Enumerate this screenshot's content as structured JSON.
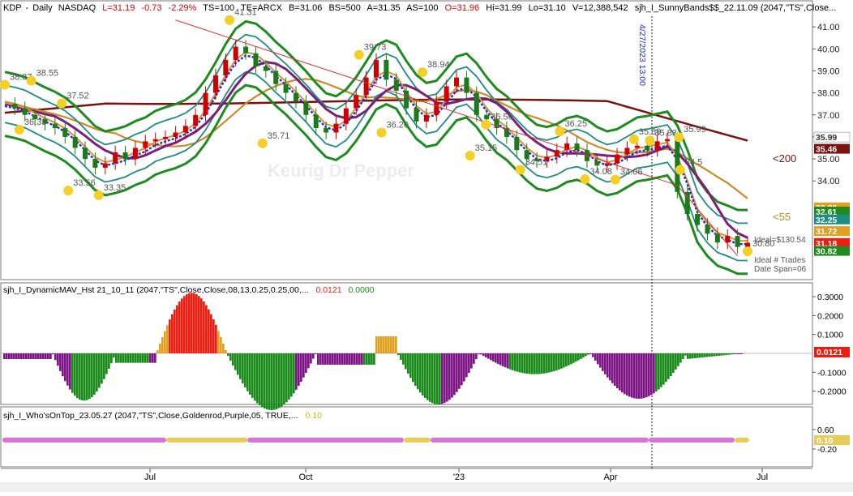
{
  "header": {
    "symbol": "KDP",
    "interval": "Daily",
    "exchange": "NASDAQ",
    "last": "L=31.19",
    "change": "-0.73",
    "change_pct": "-2.29%",
    "ts": "TS=100",
    "te": "TE=ARCX",
    "bid": "B=31.06",
    "bid_size": "BS=500",
    "ask": "A=31.35",
    "ask_size": "AS=100",
    "open": "O=31.96",
    "high": "Hi=31.99",
    "low": "Lo=31.10",
    "volume": "V=12,388,542",
    "study": "sjh_I_SunnyBands$$_22.11.09 (2047,\"TS\",Close..."
  },
  "watermark": "Keurig Dr Pepper",
  "vline_label": "4/27/2023 13:00",
  "colors": {
    "up_candle": "#cc0000",
    "down_candle": "#1c7a1c",
    "band_outer": "#1f8a1f",
    "band_mid": "#1e8c80",
    "ma200": "#7a1010",
    "ma55": "#cc8a2a",
    "dyn_blue": "#1f2ed6",
    "dyn_purple": "#7a1f7a",
    "ema_orange": "#d4943a",
    "swing_dot": "#f2d028",
    "hist_green": "#1a8a1a",
    "hist_purple": "#7d1585",
    "hist_red": "#ee1c10",
    "hist_gold": "#e0a020"
  },
  "chart_data": [
    {
      "type": "line",
      "title": "KDP - Daily NASDAQ",
      "x_ticks": [
        "Jul",
        "Oct",
        "'23",
        "Apr",
        "Jul"
      ],
      "ylim": [
        29.7,
        42.0
      ],
      "y_ticks": [
        34.0,
        35.0,
        36.0,
        37.0,
        38.0,
        39.0,
        40.0,
        41.0
      ],
      "close_series": [
        37.5,
        37.3,
        37.0,
        36.8,
        36.6,
        36.4,
        36.0,
        35.5,
        35.0,
        34.6,
        34.8,
        35.3,
        35.0,
        35.5,
        35.8,
        35.9,
        36.0,
        36.2,
        36.5,
        37.0,
        38.0,
        38.8,
        39.5,
        40.1,
        39.8,
        39.2,
        39.0,
        38.4,
        38.0,
        37.6,
        37.0,
        36.4,
        36.2,
        36.6,
        37.3,
        37.9,
        38.7,
        39.5,
        38.6,
        38.1,
        37.3,
        36.7,
        37.0,
        37.6,
        38.3,
        38.7,
        38.0,
        37.0,
        36.8,
        36.4,
        36.0,
        35.4,
        35.0,
        34.9,
        35.1,
        35.4,
        35.7,
        35.4,
        34.9,
        34.7,
        34.8,
        35.2,
        35.5,
        35.6,
        35.4,
        35.8,
        35.9,
        33.5,
        32.5,
        32.0,
        31.6,
        31.2,
        31.5,
        31.0,
        31.19
      ],
      "swing_labels": [
        {
          "x": 0.0,
          "y": 38.37,
          "label": "38.37"
        },
        {
          "x": 2.0,
          "y": 38.55,
          "label": "38.55"
        },
        {
          "x": 1.1,
          "y": 36.33,
          "label": "36.33"
        },
        {
          "x": 4.3,
          "y": 37.52,
          "label": "37.52"
        },
        {
          "x": 4.8,
          "y": 33.56,
          "label": "33.56"
        },
        {
          "x": 7.1,
          "y": 33.35,
          "label": "33.35"
        },
        {
          "x": 17.0,
          "y": 41.31,
          "label": "41.31"
        },
        {
          "x": 19.5,
          "y": 35.71,
          "label": "35.71"
        },
        {
          "x": 26.8,
          "y": 39.73,
          "label": "39.73"
        },
        {
          "x": 28.5,
          "y": 36.2,
          "label": "36.20"
        },
        {
          "x": 31.6,
          "y": 38.94,
          "label": "38.94"
        },
        {
          "x": 35.2,
          "y": 35.15,
          "label": "35.15"
        },
        {
          "x": 36.4,
          "y": 36.56,
          "label": "36.56"
        },
        {
          "x": 39.0,
          "y": 34.51,
          "label": "34.51"
        },
        {
          "x": 42.0,
          "y": 36.25,
          "label": "36.25"
        },
        {
          "x": 43.9,
          "y": 34.08,
          "label": "34.08"
        },
        {
          "x": 46.2,
          "y": 34.06,
          "label": "34.06"
        },
        {
          "x": 47.6,
          "y": 35.89,
          "label": "35.89"
        },
        {
          "x": 48.8,
          "y": 35.83,
          "label": "35.83"
        },
        {
          "x": 51.0,
          "y": 35.99,
          "label": "35.99"
        },
        {
          "x": 51.1,
          "y": 34.5,
          "label": "34.5"
        },
        {
          "x": 56.2,
          "y": 30.8,
          "label": "30.80"
        }
      ],
      "right_labels": [
        {
          "text": "<200",
          "y": 35.5
        },
        {
          "text": "<55",
          "y": 32.5
        }
      ],
      "axis_badges": [
        {
          "value": "35.99",
          "color": "#ffffff",
          "text_color": "#333333"
        },
        {
          "value": "35.46",
          "color": "#7a1010",
          "text_color": "#ffffff"
        },
        {
          "value": "32.80",
          "color": "#e0a020",
          "text_color": "#ffffff"
        },
        {
          "value": "32.61",
          "color": "#1f8a1f",
          "text_color": "#ffffff"
        },
        {
          "value": "32.25",
          "color": "#1e8c80",
          "text_color": "#ffffff"
        },
        {
          "value": "31.72",
          "color": "#e0a020",
          "text_color": "#ffffff"
        },
        {
          "value": "31.18",
          "color": "#ee1c10",
          "text_color": "#ffffff"
        },
        {
          "value": "30.82",
          "color": "#1f8a1f",
          "text_color": "#ffffff"
        }
      ],
      "overlay_notes": [
        "Ideal=$130.54",
        "Ideal # Trades",
        "Date Span=06"
      ]
    },
    {
      "type": "bar",
      "title": "sjh_I_DynamicMAV_Hst 21_10_11 (2047,\"TS\",Close,Close,08,13,0.25,0.25,00,...",
      "value_1": "0.0121",
      "value_2": "0.0000",
      "ylim": [
        -0.33,
        0.36
      ],
      "y_ticks": [
        "0.3000",
        "0.2000",
        "0.1000",
        "-0.1000",
        "-0.2000"
      ],
      "last_badge": "0.0121"
    },
    {
      "type": "line",
      "title": "sjh_I_Who'sOnTop_23.05.27 (2047,\"TS\",Close,Goldenrod,Purple,05,  TRUE,...",
      "value": "0.10",
      "y_ticks": [
        "0.60",
        "-0.20"
      ],
      "last_badge": "0.10"
    }
  ]
}
